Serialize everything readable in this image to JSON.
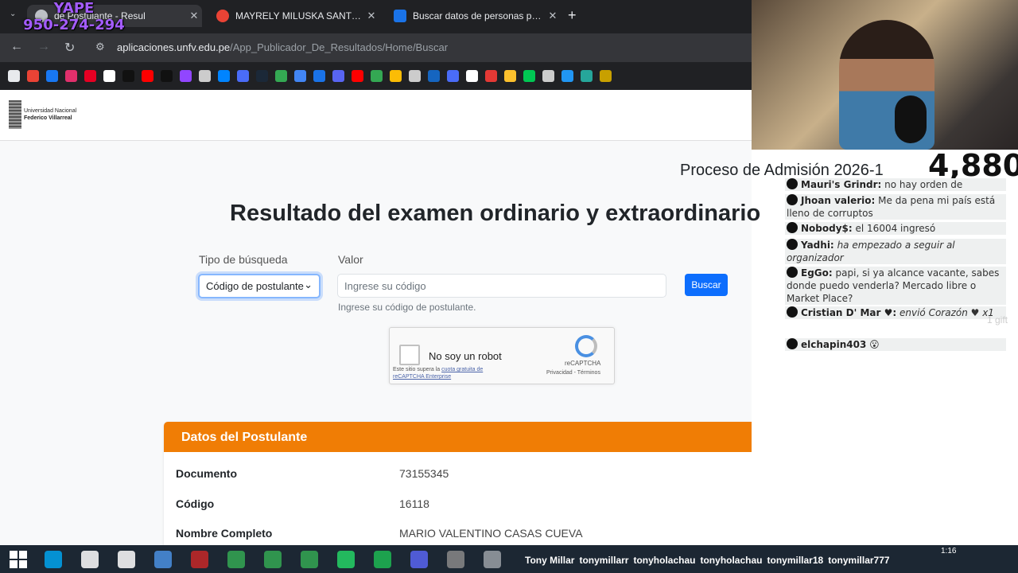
{
  "overlay": {
    "yape_label": "YAPE",
    "yape_number": "950-274-294",
    "viewer_count": "4,880"
  },
  "browser": {
    "tabs": [
      {
        "title": "de Postulante - Resul",
        "active": true
      },
      {
        "title": "MAYRELY MILUSKA SANTOS CA",
        "active": false
      },
      {
        "title": "Buscar datos de personas por D",
        "active": false
      }
    ],
    "new_tab": "+",
    "url_host": "aplicaciones.unfv.edu.pe",
    "url_path": "/App_Publicador_De_Resultados/Home/Buscar",
    "bookmark_colors": [
      "#e8eaed",
      "#ea4335",
      "#1877f2",
      "#e1306c",
      "#e60023",
      "#ffffff",
      "#111111",
      "#ff0000",
      "#111111",
      "#9146ff",
      "#cccccc",
      "#0084ff",
      "#4a6cf7",
      "#1b2838",
      "#34a853",
      "#4285f4",
      "#1a73e8",
      "#5865f2",
      "#ff0000",
      "#34a853",
      "#fbbc05",
      "#cccccc",
      "#1565c0",
      "#4a6cf7",
      "#ffffff",
      "#e53935",
      "#fbc02d",
      "#00c853",
      "#cccccc",
      "#2196f3",
      "#26a69a",
      "#c8a000"
    ]
  },
  "site": {
    "logo_line1": "Universidad Nacional",
    "logo_line2": "Federico Villarreal",
    "process_title": "Proceso de Admisión 2026-1",
    "main_title": "Resultado del examen ordinario y extraordinario"
  },
  "form": {
    "tipo_label": "Tipo de búsqueda",
    "tipo_value": "Código de postulante",
    "valor_label": "Valor",
    "valor_placeholder": "Ingrese su código",
    "valor_hint": "Ingrese su código de postulante.",
    "search_button": "Buscar"
  },
  "captcha": {
    "label": "No soy un robot",
    "note_prefix": "Este sitio supera la ",
    "note_link": "cuota gratuita de reCAPTCHA Enterprise",
    "brand": "reCAPTCHA",
    "terms": "Privacidad - Términos"
  },
  "card": {
    "header": "Datos del Postulante",
    "rows": [
      {
        "key": "Documento",
        "value": "73155345"
      },
      {
        "key": "Código",
        "value": "16118"
      },
      {
        "key": "Nombre Completo",
        "value": "MARIO VALENTINO CASAS CUEVA"
      }
    ]
  },
  "chat": [
    {
      "user": "Mauri's Grindr:",
      "text": "no hay orden de mérito..."
    },
    {
      "user": "Jhoan valerio:",
      "text": "Me da pena mi país está lleno de corruptos"
    },
    {
      "user": "Nobody$:",
      "text": "el 16004 ingresó"
    },
    {
      "user": "Yadhi:",
      "text": "ha empezado a seguir al organizador",
      "italic": true
    },
    {
      "user": "EgGo:",
      "text": "papi, si ya alcance vacante, sabes donde puedo venderla? Mercado libre o Market Place?"
    },
    {
      "user": "Cristian D' Mar ♥:",
      "text": "envió Corazón ♥ x1",
      "italic": true
    },
    {
      "user": "elchapin403",
      "text": "😮"
    }
  ],
  "gift_label": "1 gift",
  "taskbar": {
    "icon_colors": [
      "#00a4ef",
      "#ffffff",
      "#ffffff",
      "#4a90e2",
      "#c62828",
      "#34a853",
      "#34a853",
      "#34a853",
      "#25d366",
      "#1db954",
      "#5865f2",
      "#888888",
      "#9aa0a6"
    ],
    "social": [
      "Tony Millar",
      "tonymillarr",
      "tonyholachau",
      "tonyholachau",
      "tonymillar18",
      "tonymillar777"
    ],
    "clock": "1:16"
  }
}
